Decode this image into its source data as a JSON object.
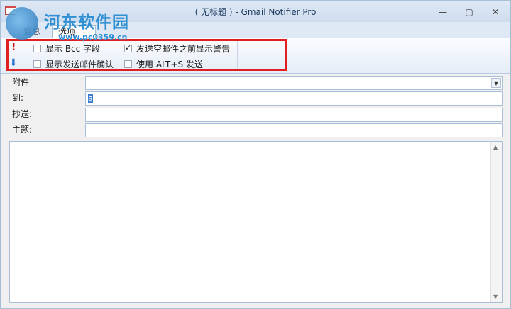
{
  "window": {
    "title": "( 无标题 ) - Gmail Notifier Pro",
    "minimize": "—",
    "maximize": "▢",
    "close": "✕"
  },
  "watermark": {
    "title": "河东软件园",
    "url": "www.pc0359.cn"
  },
  "tabs": [
    {
      "label": "信息",
      "active": false
    },
    {
      "label": "选项",
      "active": true
    }
  ],
  "options": {
    "show_bcc": {
      "label": "显示 Bcc 字段",
      "checked": false
    },
    "read_receipt": {
      "label": "显示发送邮件确认",
      "checked": false
    },
    "warn_empty_subject": {
      "label": "发送空邮件之前显示警告",
      "checked": true
    },
    "alt_s_send": {
      "label": "使用 ALT+S 发送",
      "checked": false
    }
  },
  "icons": {
    "high_importance": "!",
    "low_importance": "⬇"
  },
  "fields": {
    "attachment_label": "附件",
    "to_label": "到:",
    "to_value": "a",
    "cc_label": "抄送:",
    "subject_label": "主题:"
  },
  "colors": {
    "highlight_border": "#e02020",
    "accent": "#2f8fd2"
  }
}
